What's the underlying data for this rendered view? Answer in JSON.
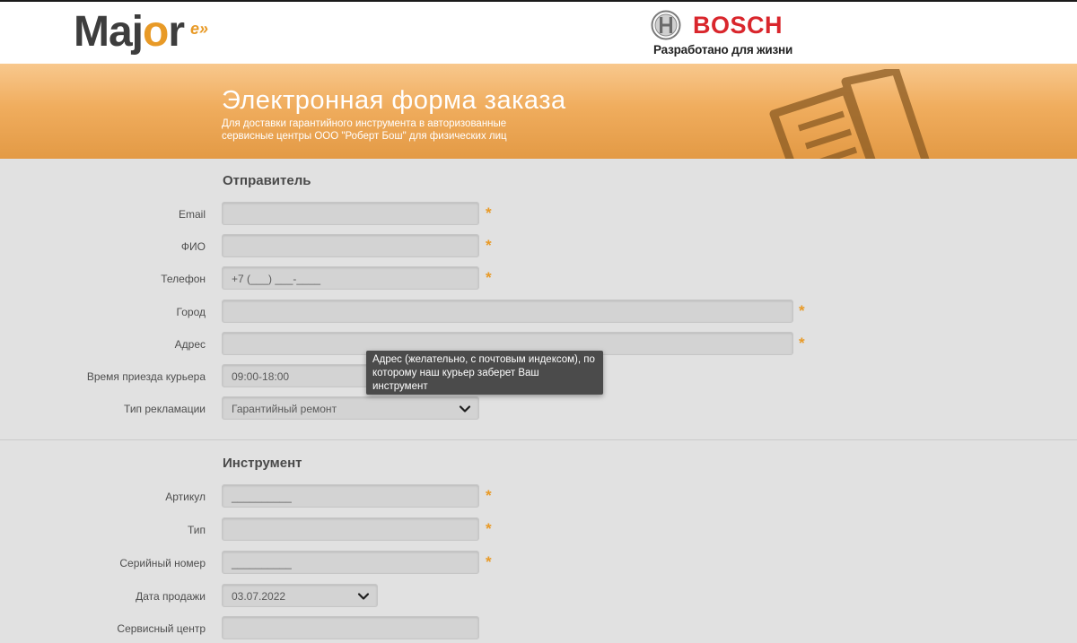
{
  "header": {
    "major_logo": {
      "text_main": "Maj",
      "text_o": "o",
      "text_r": "r",
      "text_sup": "e»"
    },
    "bosch": {
      "word": "BOSCH",
      "slogan": "Разработано для жизни"
    }
  },
  "banner": {
    "title": "Электронная форма заказа",
    "subtitle": "Для доставки гарантийного инструмента в авторизованные сервисные центры ООО \"Роберт Бош\" для физических лиц"
  },
  "sender": {
    "title": "Отправитель",
    "email": {
      "label": "Email",
      "value": ""
    },
    "fio": {
      "label": "ФИО",
      "value": ""
    },
    "phone": {
      "label": "Телефон",
      "value": "+7 (___) ___-____"
    },
    "city": {
      "label": "Город",
      "value": ""
    },
    "address": {
      "label": "Адрес",
      "value": ""
    },
    "courier_time": {
      "label": "Время приезда курьера",
      "value": "09:00-18:00"
    },
    "claim_type": {
      "label": "Тип рекламации",
      "value": "Гарантийный ремонт"
    }
  },
  "tooltip": {
    "text": "Адрес (желательно, с почтовым индексом), по которому наш курьер заберет Ваш инструмент"
  },
  "tool": {
    "title": "Инструмент",
    "article": {
      "label": "Артикул",
      "value": "__________"
    },
    "type": {
      "label": "Тип",
      "value": ""
    },
    "serial": {
      "label": "Серийный номер",
      "value": "__________"
    },
    "sale_date": {
      "label": "Дата продажи",
      "value": "03.07.2022"
    },
    "service_center": {
      "label": "Сервисный центр",
      "value": ""
    }
  },
  "required_mark": "*",
  "icons": {
    "select": "chevron-down-icon",
    "banner": "document-icon",
    "bosch": "bosch-armature-icon"
  },
  "colors": {
    "accent": "#e89a27",
    "bosch_red": "#d9262c",
    "banner_top": "#f8c88d",
    "banner_bottom": "#e39a45",
    "page_bg": "#e1e1e1",
    "field_bg": "#d3d3d3",
    "tooltip_bg": "#4b4b4b"
  }
}
